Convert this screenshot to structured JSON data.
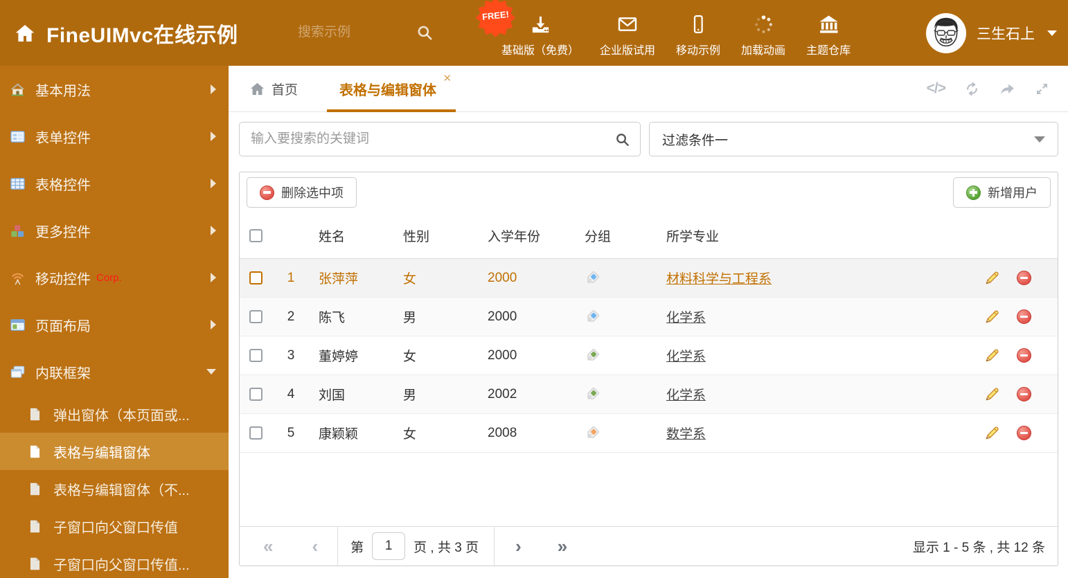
{
  "colors": {
    "header_bg": "#b06a0e",
    "sidebar_bg": "#bc7113",
    "sidebar_selected_bg": "#cb8b2f",
    "accent": "#c17000",
    "free_badge_bg": "#ff4a1a",
    "corp_badge": "#ff1a1a",
    "tag_blue": "#6db6f2",
    "tag_green": "#7ba953",
    "tag_orange": "#f5a45f",
    "delete_red": "#e1534a",
    "add_green": "#58a436"
  },
  "header": {
    "title": "FineUIMvc在线示例",
    "search_placeholder": "搜索示例",
    "free_badge": "FREE!",
    "nav": [
      {
        "label": "基础版（免费）",
        "icon": "download-icon"
      },
      {
        "label": "企业版试用",
        "icon": "envelope-icon"
      },
      {
        "label": "移动示例",
        "icon": "phone-icon"
      },
      {
        "label": "加载动画",
        "icon": "spinner-icon"
      },
      {
        "label": "主题仓库",
        "icon": "bank-icon"
      }
    ],
    "user_name": "三生石上"
  },
  "sidebar": {
    "items": [
      {
        "label": "基本用法",
        "icon": "home-colorful-icon"
      },
      {
        "label": "表单控件",
        "icon": "form-icon"
      },
      {
        "label": "表格控件",
        "icon": "table-icon"
      },
      {
        "label": "更多控件",
        "icon": "cubes-icon"
      },
      {
        "label": "移动控件",
        "icon": "signal-icon",
        "badge": "Corp."
      },
      {
        "label": "页面布局",
        "icon": "layout-icon"
      },
      {
        "label": "内联框架",
        "icon": "frames-icon",
        "expanded": true
      }
    ],
    "subitems": [
      {
        "label": "弹出窗体（本页面或..."
      },
      {
        "label": "表格与编辑窗体",
        "active": true
      },
      {
        "label": "表格与编辑窗体（不..."
      },
      {
        "label": "子窗口向父窗口传值"
      },
      {
        "label": "子窗口向父窗口传值..."
      }
    ]
  },
  "tabs": {
    "home": "首页",
    "active": "表格与编辑窗体"
  },
  "filters": {
    "search_placeholder": "输入要搜索的关键词",
    "filter_value": "过滤条件一"
  },
  "grid": {
    "delete_button": "删除选中项",
    "add_button": "新增用户",
    "columns": [
      "姓名",
      "性别",
      "入学年份",
      "分组",
      "所学专业"
    ],
    "rows": [
      {
        "index": "1",
        "name": "张萍萍",
        "gender": "女",
        "year": "2000",
        "tag": "blue",
        "major": "材料科学与工程系",
        "highlight": true
      },
      {
        "index": "2",
        "name": "陈飞",
        "gender": "男",
        "year": "2000",
        "tag": "blue",
        "major": "化学系"
      },
      {
        "index": "3",
        "name": "董婷婷",
        "gender": "女",
        "year": "2000",
        "tag": "green",
        "major": "化学系"
      },
      {
        "index": "4",
        "name": "刘国",
        "gender": "男",
        "year": "2002",
        "tag": "green",
        "major": "化学系"
      },
      {
        "index": "5",
        "name": "康颖颖",
        "gender": "女",
        "year": "2008",
        "tag": "orange",
        "major": "数学系"
      }
    ],
    "pagination": {
      "prefix": "第",
      "page": "1",
      "suffix": "页 , 共 3 页",
      "summary": "显示 1 - 5 条 , 共 12 条"
    }
  }
}
